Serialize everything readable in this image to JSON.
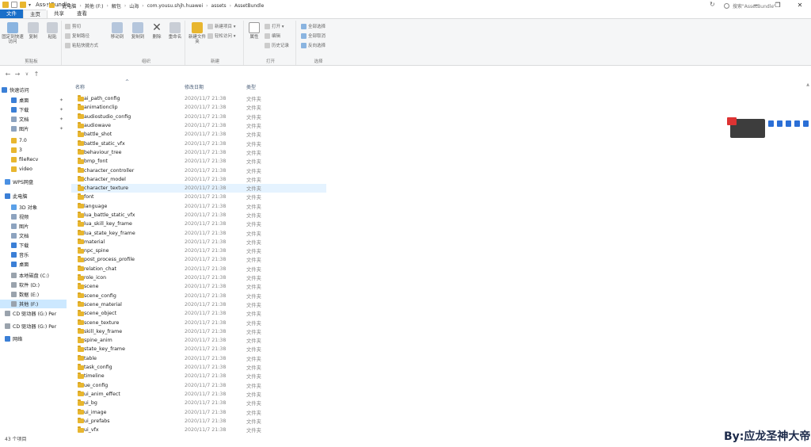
{
  "window": {
    "title": "AssetBundle"
  },
  "ribbon_tabs": [
    "文件",
    "主页",
    "共享",
    "查看"
  ],
  "ribbon": {
    "groups": [
      {
        "label": "剪贴板",
        "big_buttons": [
          "固定到快速访问",
          "复制",
          "粘贴"
        ],
        "small_buttons": [
          "剪切",
          "复制路径",
          "粘贴快捷方式"
        ]
      },
      {
        "label": "组织",
        "big_buttons": [
          "移动到",
          "复制到",
          "删除",
          "重命名"
        ]
      },
      {
        "label": "新建",
        "big_buttons": [
          "新建文件夹"
        ],
        "small_buttons": [
          "新建项目 ▾",
          "轻松访问 ▾"
        ]
      },
      {
        "label": "打开",
        "big_buttons": [
          "属性"
        ],
        "small_buttons": [
          "打开 ▾",
          "编辑",
          "历史记录"
        ]
      },
      {
        "label": "选择",
        "small_buttons": [
          "全部选择",
          "全部取消",
          "反向选择"
        ]
      }
    ]
  },
  "address": {
    "crumbs": [
      "此电脑",
      "其他 (F:)",
      "解包",
      "山海",
      "com.yousu.shjh.huawei",
      "assets",
      "AssetBundle"
    ],
    "search_placeholder": "搜索\"AssetBundle\""
  },
  "nav_pane": [
    {
      "label": "快速访问",
      "icon": "star-icon",
      "pinned": false
    },
    {
      "label": "桌面",
      "icon": "desktop-icon",
      "pinned": true
    },
    {
      "label": "下载",
      "icon": "download-icon",
      "pinned": true
    },
    {
      "label": "文档",
      "icon": "document-icon",
      "pinned": true
    },
    {
      "label": "图片",
      "icon": "picture-icon",
      "pinned": true
    },
    {
      "label": "7.0",
      "icon": "folder-icon",
      "pinned": false
    },
    {
      "label": "3",
      "icon": "folder-icon",
      "pinned": false
    },
    {
      "label": "fileRecv",
      "icon": "folder-icon",
      "pinned": false
    },
    {
      "label": "video",
      "icon": "folder-icon",
      "pinned": false
    },
    {
      "label": "WPS网盘",
      "icon": "cloud-icon",
      "pinned": false
    },
    {
      "label": "此电脑",
      "icon": "computer-icon",
      "pinned": false
    },
    {
      "label": "3D 对象",
      "icon": "cube-icon",
      "pinned": false
    },
    {
      "label": "视频",
      "icon": "video-icon",
      "pinned": false
    },
    {
      "label": "图片",
      "icon": "picture-icon",
      "pinned": false
    },
    {
      "label": "文档",
      "icon": "document-icon",
      "pinned": false
    },
    {
      "label": "下载",
      "icon": "download-icon",
      "pinned": false
    },
    {
      "label": "音乐",
      "icon": "music-icon",
      "pinned": false
    },
    {
      "label": "桌面",
      "icon": "desktop-icon",
      "pinned": false
    },
    {
      "label": "本地磁盘 (C:)",
      "icon": "drive-icon",
      "pinned": false
    },
    {
      "label": "软件 (D:)",
      "icon": "drive-icon",
      "pinned": false
    },
    {
      "label": "数据 (E:)",
      "icon": "drive-icon",
      "pinned": false
    },
    {
      "label": "其他 (F:)",
      "icon": "drive-icon",
      "pinned": false,
      "selected": true
    },
    {
      "label": "CD 驱动器 (G:) Per",
      "icon": "cd-icon",
      "pinned": false
    },
    {
      "label": "CD 驱动器 (G:) Per",
      "icon": "cd-icon",
      "pinned": false
    },
    {
      "label": "网络",
      "icon": "network-icon",
      "pinned": false
    }
  ],
  "columns": {
    "name": "名称",
    "date": "修改日期",
    "type": "类型"
  },
  "files": [
    {
      "name": "ai_path_config",
      "date": "2020/11/7 21:38",
      "type": "文件夹"
    },
    {
      "name": "animationclip",
      "date": "2020/11/7 21:38",
      "type": "文件夹"
    },
    {
      "name": "audiostudio_config",
      "date": "2020/11/7 21:38",
      "type": "文件夹"
    },
    {
      "name": "audiowave",
      "date": "2020/11/7 21:38",
      "type": "文件夹"
    },
    {
      "name": "battle_shot",
      "date": "2020/11/7 21:38",
      "type": "文件夹"
    },
    {
      "name": "battle_static_vfx",
      "date": "2020/11/7 21:38",
      "type": "文件夹"
    },
    {
      "name": "behaviour_tree",
      "date": "2020/11/7 21:38",
      "type": "文件夹"
    },
    {
      "name": "bmp_font",
      "date": "2020/11/7 21:38",
      "type": "文件夹"
    },
    {
      "name": "character_controller",
      "date": "2020/11/7 21:38",
      "type": "文件夹"
    },
    {
      "name": "character_model",
      "date": "2020/11/7 21:38",
      "type": "文件夹"
    },
    {
      "name": "character_texture",
      "date": "2020/11/7 21:38",
      "type": "文件夹",
      "selected": true
    },
    {
      "name": "font",
      "date": "2020/11/7 21:38",
      "type": "文件夹"
    },
    {
      "name": "language",
      "date": "2020/11/7 21:38",
      "type": "文件夹"
    },
    {
      "name": "lua_battle_static_vfx",
      "date": "2020/11/7 21:38",
      "type": "文件夹"
    },
    {
      "name": "lua_skill_key_frame",
      "date": "2020/11/7 21:38",
      "type": "文件夹"
    },
    {
      "name": "lua_state_key_frame",
      "date": "2020/11/7 21:38",
      "type": "文件夹"
    },
    {
      "name": "material",
      "date": "2020/11/7 21:38",
      "type": "文件夹"
    },
    {
      "name": "npc_spine",
      "date": "2020/11/7 21:38",
      "type": "文件夹"
    },
    {
      "name": "post_process_profile",
      "date": "2020/11/7 21:38",
      "type": "文件夹"
    },
    {
      "name": "relation_chat",
      "date": "2020/11/7 21:38",
      "type": "文件夹"
    },
    {
      "name": "role_icon",
      "date": "2020/11/7 21:38",
      "type": "文件夹"
    },
    {
      "name": "scene",
      "date": "2020/11/7 21:38",
      "type": "文件夹"
    },
    {
      "name": "scene_config",
      "date": "2020/11/7 21:38",
      "type": "文件夹"
    },
    {
      "name": "scene_material",
      "date": "2020/11/7 21:38",
      "type": "文件夹"
    },
    {
      "name": "scene_object",
      "date": "2020/11/7 21:38",
      "type": "文件夹"
    },
    {
      "name": "scene_texture",
      "date": "2020/11/7 21:38",
      "type": "文件夹"
    },
    {
      "name": "skill_key_frame",
      "date": "2020/11/7 21:38",
      "type": "文件夹"
    },
    {
      "name": "spine_anim",
      "date": "2020/11/7 21:38",
      "type": "文件夹"
    },
    {
      "name": "state_key_frame",
      "date": "2020/11/7 21:38",
      "type": "文件夹"
    },
    {
      "name": "table",
      "date": "2020/11/7 21:38",
      "type": "文件夹"
    },
    {
      "name": "task_config",
      "date": "2020/11/7 21:38",
      "type": "文件夹"
    },
    {
      "name": "timeline",
      "date": "2020/11/7 21:38",
      "type": "文件夹"
    },
    {
      "name": "ue_config",
      "date": "2020/11/7 21:38",
      "type": "文件夹"
    },
    {
      "name": "ui_anim_effect",
      "date": "2020/11/7 21:38",
      "type": "文件夹"
    },
    {
      "name": "ui_bg",
      "date": "2020/11/7 21:38",
      "type": "文件夹"
    },
    {
      "name": "ui_image",
      "date": "2020/11/7 21:38",
      "type": "文件夹"
    },
    {
      "name": "ui_prefabs",
      "date": "2020/11/7 21:38",
      "type": "文件夹"
    },
    {
      "name": "ui_vfx",
      "date": "2020/11/7 21:38",
      "type": "文件夹"
    }
  ],
  "status": {
    "count": "43 个项目"
  },
  "watermark": "By:应龙圣神大帝",
  "colors": {
    "file_tab": "#1a6fc9",
    "selection": "#cce8ff",
    "folder": "#e8b62f"
  }
}
